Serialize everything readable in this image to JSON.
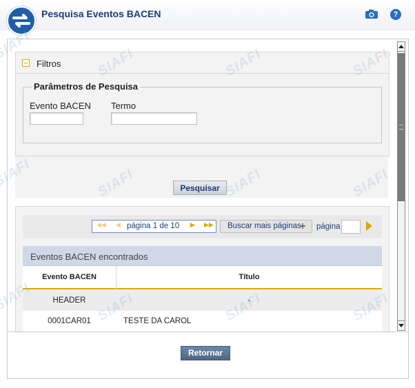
{
  "header": {
    "title": "Pesquisa Eventos BACEN",
    "help_label": "?"
  },
  "filters": {
    "panel_label": "Filtros",
    "fieldset_legend": "Parâmetros de Pesquisa",
    "evento_label": "Evento BACEN",
    "evento_value": "",
    "termo_label": "Termo",
    "termo_value": "",
    "search_button": "Pesquisar"
  },
  "pager": {
    "text": "página 1 de 10",
    "more_button": "Buscar mais páginas",
    "page_label": "página",
    "page_value": ""
  },
  "results": {
    "title": "Eventos BACEN encontrados",
    "columns": [
      "Evento BACEN",
      "Título"
    ],
    "rows": [
      {
        "evento": "HEADER",
        "titulo": "-"
      },
      {
        "evento": "0001CAR01",
        "titulo": "TESTE DA CAROL"
      }
    ]
  },
  "footer": {
    "return_button": "Retornar"
  },
  "watermark": "SIAFI",
  "colors": {
    "accent": "#e0a400",
    "brand": "#1d3c78",
    "header_grid": "#cfd8e6"
  }
}
